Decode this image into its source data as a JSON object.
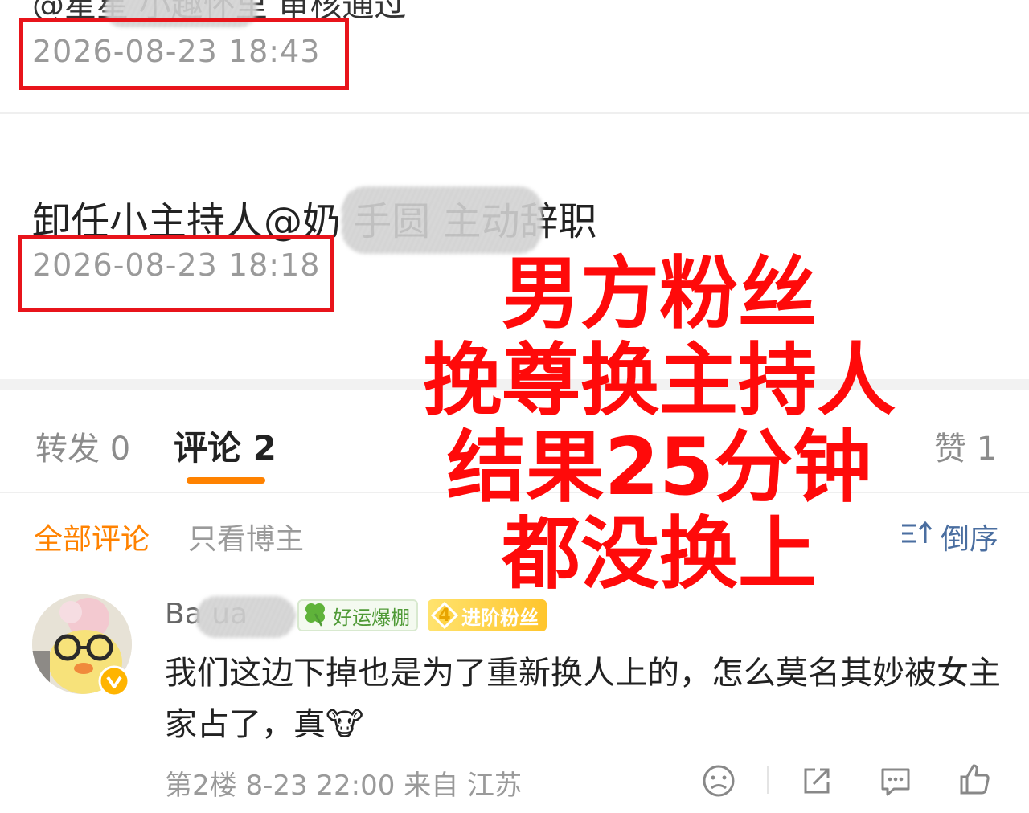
{
  "post_1": {
    "text": "@星星 小趣怀里 审核通过",
    "time": "2026-08-23 18:43"
  },
  "post_2": {
    "text": "卸任小主持人@奶 手圆 主动辞职",
    "time": "2026-08-23 18:18"
  },
  "overlay": {
    "lines": [
      "男方粉丝",
      "挽尊换主持人",
      "结果25分钟",
      "都没换上"
    ],
    "color": "#ff0a0a"
  },
  "tabs": {
    "repost_label": "转发 0",
    "comment_label": "评论 2",
    "like_label": "赞 1"
  },
  "filters": {
    "all_comments": "全部评论",
    "blogger_only": "只看博主",
    "sort_label": "倒序"
  },
  "comment": {
    "username": "Ba ua",
    "badge_lucky": "好运爆棚",
    "badge_fan_level": "4",
    "badge_fan": "进阶粉丝",
    "text": "我们这边下掉也是为了重新换人上的，怎么莫名其妙被女主家占了，真🐮",
    "meta": "第2楼 8-23 22:00 来自 江苏"
  },
  "icons": {
    "sort": "sort-ascending-icon",
    "verify": "verified-v-icon",
    "emoji": "sad-face-icon",
    "share": "share-icon",
    "reply": "comment-icon",
    "like": "thumbs-up-icon",
    "clover": "clover-icon"
  },
  "colors": {
    "accent": "#ff8200",
    "highlight_box": "#e8141b",
    "link_blue": "#4a6ea0"
  }
}
